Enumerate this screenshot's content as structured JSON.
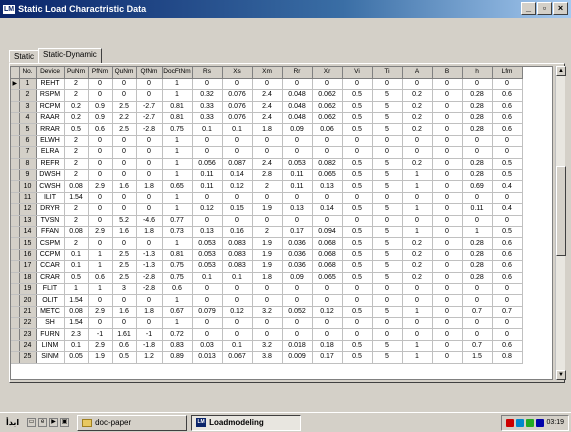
{
  "window": {
    "app_icon": "LM",
    "title": "Static Load Charactristic Data",
    "min_label": "_",
    "max_label": "▫",
    "close_label": "×"
  },
  "tabs": [
    {
      "label": "Static",
      "active": false
    },
    {
      "label": "Static-Dynamic",
      "active": true
    }
  ],
  "table": {
    "headers": [
      "No.",
      "Device",
      "PuNm",
      "PfNm",
      "QuNm",
      "QfNm",
      "DocFtNm",
      "Rs",
      "Xs",
      "Xm",
      "Rr",
      "Xr",
      "Vi",
      "Ti",
      "A",
      "B",
      "h",
      "Lfm"
    ],
    "rows": [
      [
        "1",
        "REHT",
        "2",
        "0",
        "0",
        "0",
        "1",
        "0",
        "0",
        "0",
        "0",
        "0",
        "0",
        "0",
        "0",
        "0",
        "0",
        "0"
      ],
      [
        "2",
        "RSPM",
        "2",
        "0",
        "0",
        "0",
        "1",
        "0.32",
        "0.076",
        "2.4",
        "0.048",
        "0.062",
        "0.5",
        "5",
        "0.2",
        "0",
        "0.28",
        "0.6"
      ],
      [
        "3",
        "RCPM",
        "0.2",
        "0.9",
        "2.5",
        "-2.7",
        "0.81",
        "0.33",
        "0.076",
        "2.4",
        "0.048",
        "0.062",
        "0.5",
        "5",
        "0.2",
        "0",
        "0.28",
        "0.6"
      ],
      [
        "4",
        "RAAR",
        "0.2",
        "0.9",
        "2.2",
        "-2.7",
        "0.81",
        "0.33",
        "0.076",
        "2.4",
        "0.048",
        "0.062",
        "0.5",
        "5",
        "0.2",
        "0",
        "0.28",
        "0.6"
      ],
      [
        "5",
        "RRAR",
        "0.5",
        "0.6",
        "2.5",
        "-2.8",
        "0.75",
        "0.1",
        "0.1",
        "1.8",
        "0.09",
        "0.06",
        "0.5",
        "5",
        "0.2",
        "0",
        "0.28",
        "0.6"
      ],
      [
        "6",
        "ELWH",
        "2",
        "0",
        "0",
        "0",
        "1",
        "0",
        "0",
        "0",
        "0",
        "0",
        "0",
        "0",
        "0",
        "0",
        "0",
        "0"
      ],
      [
        "7",
        "ELRA",
        "2",
        "0",
        "0",
        "0",
        "1",
        "0",
        "0",
        "0",
        "0",
        "0",
        "0",
        "0",
        "0",
        "0",
        "0",
        "0"
      ],
      [
        "8",
        "REFR",
        "2",
        "0",
        "0",
        "0",
        "1",
        "0.056",
        "0.087",
        "2.4",
        "0.053",
        "0.082",
        "0.5",
        "5",
        "0.2",
        "0",
        "0.28",
        "0.5"
      ],
      [
        "9",
        "DWSH",
        "2",
        "0",
        "0",
        "0",
        "1",
        "0.11",
        "0.14",
        "2.8",
        "0.11",
        "0.065",
        "0.5",
        "5",
        "1",
        "0",
        "0.28",
        "0.5"
      ],
      [
        "10",
        "CWSH",
        "0.08",
        "2.9",
        "1.6",
        "1.8",
        "0.65",
        "0.11",
        "0.12",
        "2",
        "0.11",
        "0.13",
        "0.5",
        "5",
        "1",
        "0",
        "0.69",
        "0.4"
      ],
      [
        "11",
        "ILIT",
        "1.54",
        "0",
        "0",
        "0",
        "1",
        "0",
        "0",
        "0",
        "0",
        "0",
        "0",
        "0",
        "0",
        "0",
        "0",
        "0"
      ],
      [
        "12",
        "DRYR",
        "2",
        "0",
        "0",
        "0",
        "1",
        "0.12",
        "0.15",
        "1.9",
        "0.13",
        "0.14",
        "0.5",
        "5",
        "1",
        "0",
        "0.11",
        "0.4"
      ],
      [
        "13",
        "TVSN",
        "2",
        "0",
        "5.2",
        "-4.6",
        "0.77",
        "0",
        "0",
        "0",
        "0",
        "0",
        "0",
        "0",
        "0",
        "0",
        "0",
        "0"
      ],
      [
        "14",
        "FFAN",
        "0.08",
        "2.9",
        "1.6",
        "1.8",
        "0.73",
        "0.13",
        "0.16",
        "2",
        "0.17",
        "0.094",
        "0.5",
        "5",
        "1",
        "0",
        "1",
        "0.5"
      ],
      [
        "15",
        "CSPM",
        "2",
        "0",
        "0",
        "0",
        "1",
        "0.053",
        "0.083",
        "1.9",
        "0.036",
        "0.068",
        "0.5",
        "5",
        "0.2",
        "0",
        "0.28",
        "0.6"
      ],
      [
        "16",
        "CCPM",
        "0.1",
        "1",
        "2.5",
        "-1.3",
        "0.81",
        "0.053",
        "0.083",
        "1.9",
        "0.036",
        "0.068",
        "0.5",
        "5",
        "0.2",
        "0",
        "0.28",
        "0.6"
      ],
      [
        "17",
        "CCAR",
        "0.1",
        "1",
        "2.5",
        "-1.3",
        "0.75",
        "0.053",
        "0.083",
        "1.9",
        "0.036",
        "0.068",
        "0.5",
        "5",
        "0.2",
        "0",
        "0.28",
        "0.6"
      ],
      [
        "18",
        "CRAR",
        "0.5",
        "0.6",
        "2.5",
        "-2.8",
        "0.75",
        "0.1",
        "0.1",
        "1.8",
        "0.09",
        "0.065",
        "0.5",
        "5",
        "0.2",
        "0",
        "0.28",
        "0.6"
      ],
      [
        "19",
        "FLIT",
        "1",
        "1",
        "3",
        "-2.8",
        "0.6",
        "0",
        "0",
        "0",
        "0",
        "0",
        "0",
        "0",
        "0",
        "0",
        "0",
        "0"
      ],
      [
        "20",
        "OLIT",
        "1.54",
        "0",
        "0",
        "0",
        "1",
        "0",
        "0",
        "0",
        "0",
        "0",
        "0",
        "0",
        "0",
        "0",
        "0",
        "0"
      ],
      [
        "21",
        "METC",
        "0.08",
        "2.9",
        "1.6",
        "1.8",
        "0.67",
        "0.079",
        "0.12",
        "3.2",
        "0.052",
        "0.12",
        "0.5",
        "5",
        "1",
        "0",
        "0.7",
        "0.7"
      ],
      [
        "22",
        "SH",
        "1.54",
        "0",
        "0",
        "0",
        "1",
        "0",
        "0",
        "0",
        "0",
        "0",
        "0",
        "0",
        "0",
        "0",
        "0",
        "0"
      ],
      [
        "23",
        "FURN",
        "2.3",
        "-1",
        "1.61",
        "-1",
        "0.72",
        "0",
        "0",
        "0",
        "0",
        "0",
        "0",
        "0",
        "0",
        "0",
        "0",
        "0"
      ],
      [
        "24",
        "LINM",
        "0.1",
        "2.9",
        "0.6",
        "-1.8",
        "0.83",
        "0.03",
        "0.1",
        "3.2",
        "0.018",
        "0.18",
        "0.5",
        "5",
        "1",
        "0",
        "0.7",
        "0.6"
      ],
      [
        "25",
        "SINM",
        "0.05",
        "1.9",
        "0.5",
        "1.2",
        "0.89",
        "0.013",
        "0.067",
        "3.8",
        "0.009",
        "0.17",
        "0.5",
        "5",
        "1",
        "0",
        "1.5",
        "0.8"
      ]
    ],
    "current_row_indicator": "▶"
  },
  "scrollbar": {
    "up": "▲",
    "down": "▼"
  },
  "taskbar": {
    "start_label": "ابدأ",
    "tasks": [
      {
        "label": "doc-paper",
        "active": false
      },
      {
        "label": "Loadmodeling",
        "active": true
      }
    ],
    "clock": "03:19"
  }
}
